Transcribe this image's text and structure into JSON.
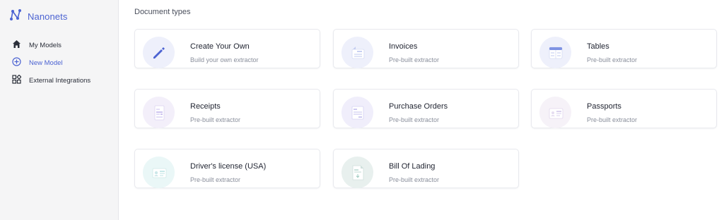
{
  "app": {
    "name": "Nanonets"
  },
  "sidebar": {
    "items": [
      {
        "label": "My Models",
        "icon": "home-icon",
        "active": false
      },
      {
        "label": "New Model",
        "icon": "plus-circle-icon",
        "active": true
      },
      {
        "label": "External Integrations",
        "icon": "integrations-icon",
        "active": false
      }
    ]
  },
  "main": {
    "section_title": "Document types",
    "cards": [
      {
        "title": "Create Your Own",
        "subtitle": "Build your own extractor",
        "icon": "pencil-icon"
      },
      {
        "title": "Invoices",
        "subtitle": "Pre-built extractor",
        "icon": "invoice-icon"
      },
      {
        "title": "Tables",
        "subtitle": "Pre-built extractor",
        "icon": "table-icon"
      },
      {
        "title": "Receipts",
        "subtitle": "Pre-built extractor",
        "icon": "receipt-icon"
      },
      {
        "title": "Purchase Orders",
        "subtitle": "Pre-built extractor",
        "icon": "purchase-order-icon"
      },
      {
        "title": "Passports",
        "subtitle": "Pre-built extractor",
        "icon": "passport-icon"
      },
      {
        "title": "Driver's license (USA)",
        "subtitle": "Pre-built extractor",
        "icon": "drivers-license-icon"
      },
      {
        "title": "Bill Of Lading",
        "subtitle": "Pre-built extractor",
        "icon": "bill-of-lading-icon"
      }
    ]
  },
  "colors": {
    "accent": "#4c63d2",
    "sidebar_bg": "#f5f5f6",
    "card_border": "#e8e9ee"
  }
}
